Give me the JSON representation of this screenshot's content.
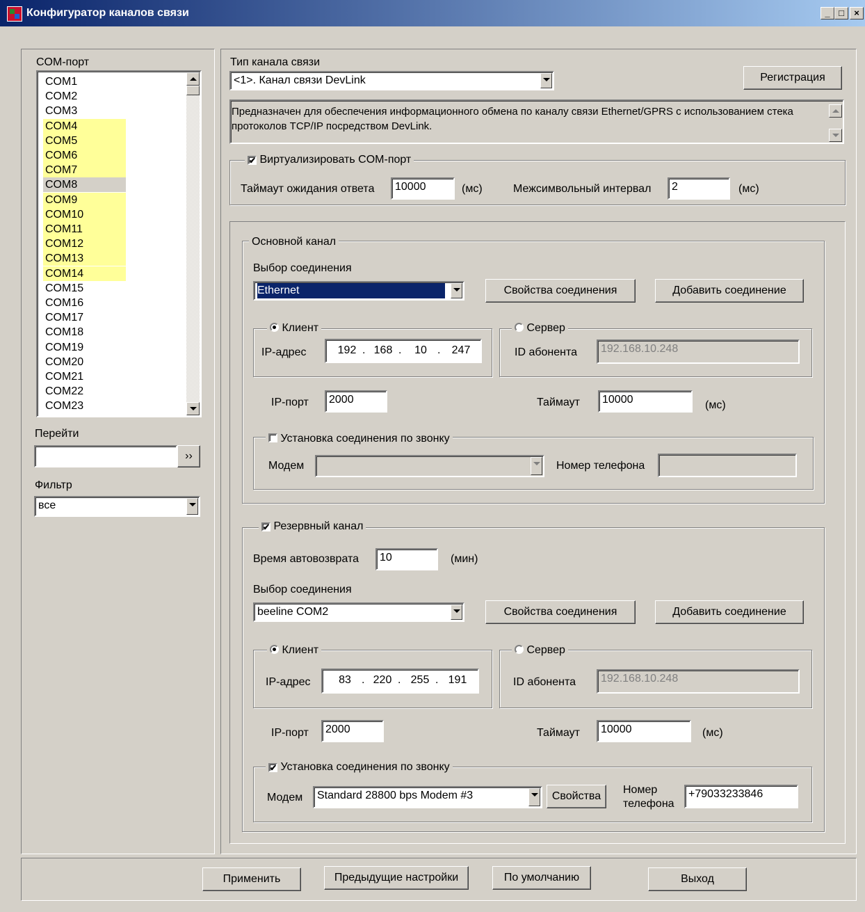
{
  "window": {
    "title": "Конфигуратор каналов связи",
    "min": "_",
    "max": "□",
    "close": "×"
  },
  "left": {
    "com_label": "COM-порт",
    "ports": [
      {
        "name": "COM1",
        "state": "normal"
      },
      {
        "name": "COM2",
        "state": "normal"
      },
      {
        "name": "COM3",
        "state": "normal"
      },
      {
        "name": "COM4",
        "state": "highlight"
      },
      {
        "name": "COM5",
        "state": "highlight"
      },
      {
        "name": "COM6",
        "state": "highlight"
      },
      {
        "name": "COM7",
        "state": "highlight"
      },
      {
        "name": "COM8",
        "state": "selected"
      },
      {
        "name": "COM9",
        "state": "highlight"
      },
      {
        "name": "COM10",
        "state": "highlight"
      },
      {
        "name": "COM11",
        "state": "highlight"
      },
      {
        "name": "COM12",
        "state": "highlight"
      },
      {
        "name": "COM13",
        "state": "highlight"
      },
      {
        "name": "COM14",
        "state": "highlight"
      },
      {
        "name": "COM15",
        "state": "normal"
      },
      {
        "name": "COM16",
        "state": "normal"
      },
      {
        "name": "COM17",
        "state": "normal"
      },
      {
        "name": "COM18",
        "state": "normal"
      },
      {
        "name": "COM19",
        "state": "normal"
      },
      {
        "name": "COM20",
        "state": "normal"
      },
      {
        "name": "COM21",
        "state": "normal"
      },
      {
        "name": "COM22",
        "state": "normal"
      },
      {
        "name": "COM23",
        "state": "normal"
      }
    ],
    "goto_label": "Перейти",
    "goto_value": "",
    "goto_button": "››",
    "filter_label": "Фильтр",
    "filter_value": "все"
  },
  "channel": {
    "type_label": "Тип канала связи",
    "type_value": "<1>. Канал связи DevLink",
    "register_button": "Регистрация",
    "description": "Предназначен для обеспечения информационного обмена по каналу связи Ethernet/GPRS с использованием стека протоколов TCP/IP посредством DevLink.",
    "virtualize_label": "Виртуализировать COM-порт",
    "virtualize_checked": true,
    "timeout_label": "Таймаут ожидания ответа",
    "timeout_value": "10000",
    "ms": "(мс)",
    "interval_label": "Межсимвольный интервал",
    "interval_value": "2"
  },
  "primary": {
    "title": "Основной канал",
    "conn_label": "Выбор соединения",
    "conn_value": "Ethernet",
    "props_button": "Свойства соединения",
    "add_button": "Добавить соединение",
    "client_label": "Клиент",
    "server_label": "Сервер",
    "ip_label": "IP-адрес",
    "ip": [
      "192",
      "168",
      "10",
      "247"
    ],
    "subscriber_label": "ID абонента",
    "subscriber_value": "192.168.10.248",
    "port_label": "IP-порт",
    "port_value": "2000",
    "timeout_label": "Таймаут",
    "timeout_value": "10000",
    "ms": "(мс)",
    "call_label": "Установка соединения по звонку",
    "call_checked": false,
    "modem_label": "Модем",
    "modem_value": "",
    "phone_label": "Номер телефона",
    "phone_value": ""
  },
  "backup": {
    "title": "Резервный канал",
    "enabled": true,
    "autoreturn_label": "Время автовозврата",
    "autoreturn_value": "10",
    "min": "(мин)",
    "conn_label": "Выбор соединения",
    "conn_value": "beeline COM2",
    "props_button": "Свойства соединения",
    "add_button": "Добавить соединение",
    "client_label": "Клиент",
    "server_label": "Сервер",
    "ip_label": "IP-адрес",
    "ip": [
      "83",
      "220",
      "255",
      "191"
    ],
    "subscriber_label": "ID абонента",
    "subscriber_value": "192.168.10.248",
    "port_label": "IP-порт",
    "port_value": "2000",
    "timeout_label": "Таймаут",
    "timeout_value": "10000",
    "ms": "(мс)",
    "call_label": "Установка соединения по звонку",
    "call_checked": true,
    "modem_label": "Модем",
    "modem_value": "Standard 28800 bps Modem #3",
    "modem_props_button": "Свойства",
    "phone_label_1": "Номер",
    "phone_label_2": "телефона",
    "phone_value": "+79033233846"
  },
  "footer": {
    "apply": "Применить",
    "previous": "Предыдущие настройки",
    "default": "По умолчанию",
    "exit": "Выход"
  },
  "colors": {
    "title_start": "#0a246a",
    "title_end": "#a6caf0",
    "highlight": "#ffff99",
    "selection": "#0a246a",
    "face": "#d4d0c8"
  }
}
